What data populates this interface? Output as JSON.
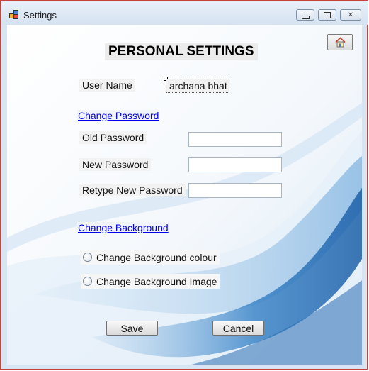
{
  "window": {
    "title": "Settings",
    "icon": "settings-app-icon",
    "controls": [
      "minimize-icon",
      "maximize-icon",
      "close-icon"
    ],
    "border_color": "#c8433a"
  },
  "toolbar": {
    "home_icon": "home-icon"
  },
  "heading": "PERSONAL SETTINGS",
  "user": {
    "label": "User Name",
    "value": "archana bhat"
  },
  "password": {
    "link": "Change Password",
    "old_label": "Old Password",
    "new_label": "New Password",
    "retype_label": "Retype New Password",
    "old_value": "",
    "new_value": "",
    "retype_value": ""
  },
  "background": {
    "link": "Change Background",
    "option_colour": "Change Background colour",
    "option_image": "Change Background Image"
  },
  "actions": {
    "save": "Save",
    "cancel": "Cancel"
  },
  "colors": {
    "link": "#0000ee",
    "swoosh": "#3d86c9"
  }
}
